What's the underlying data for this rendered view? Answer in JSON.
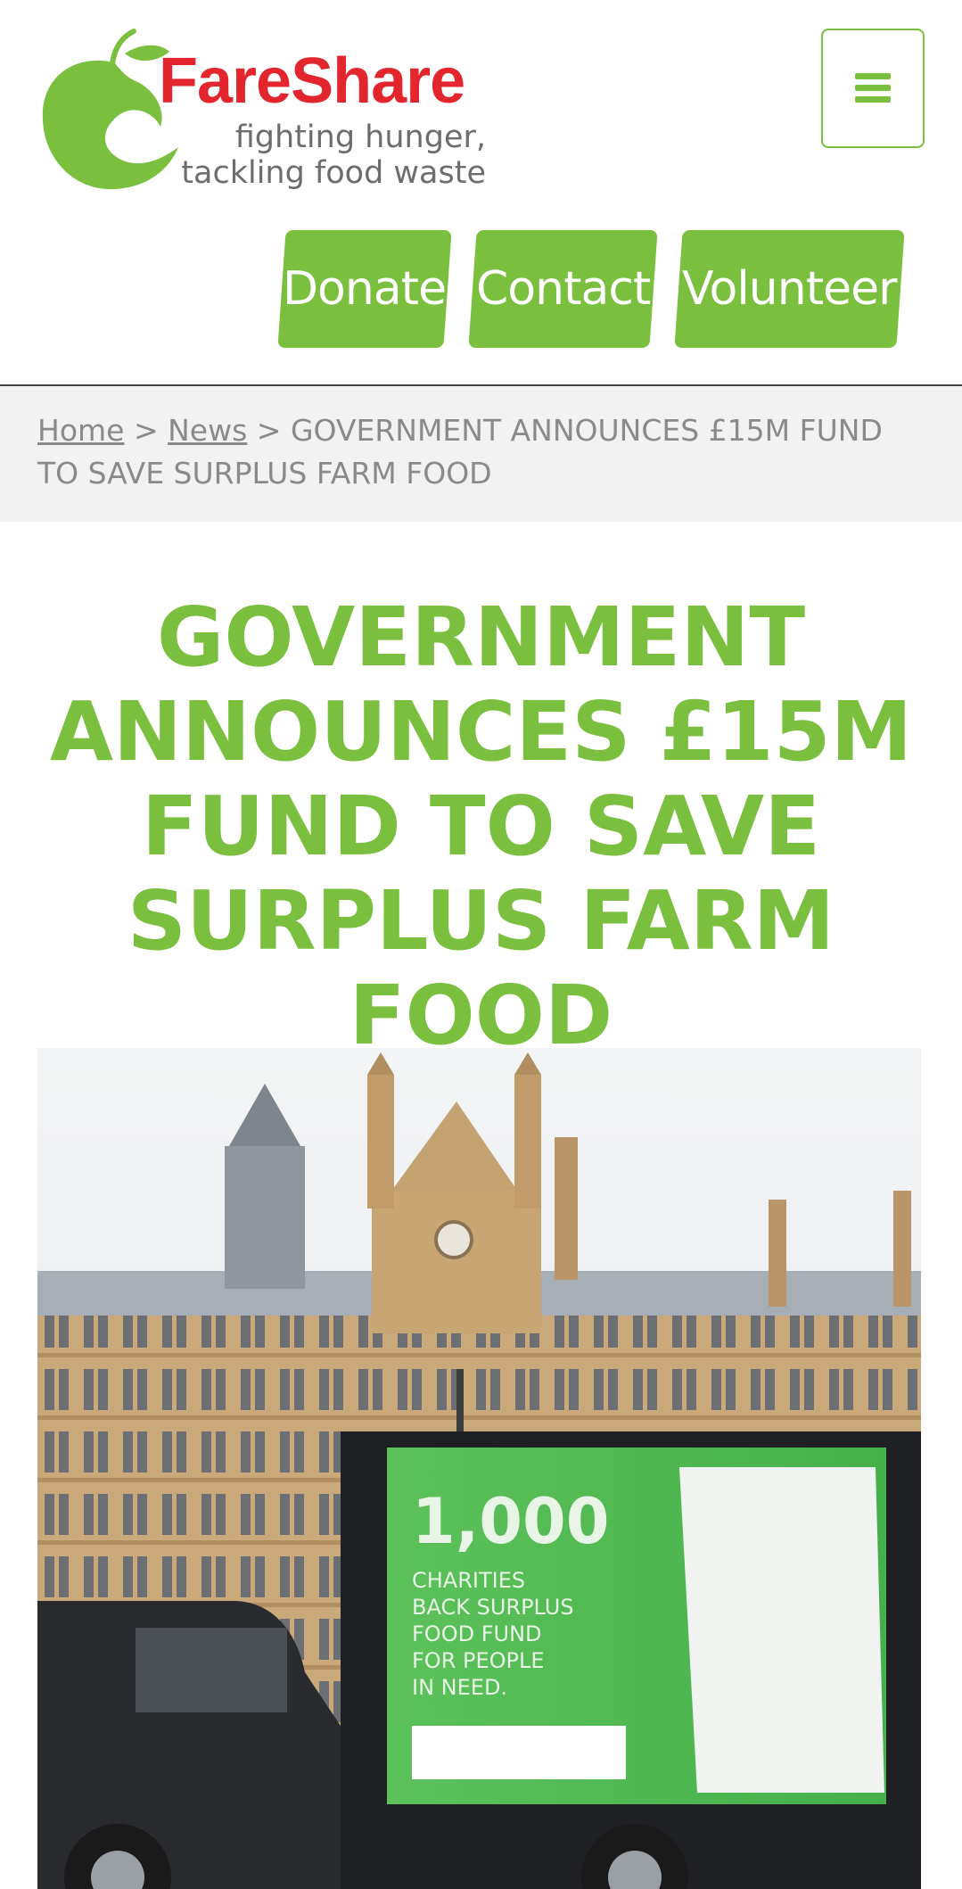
{
  "brand": {
    "name_part1": "Fare",
    "name_part2": "Share",
    "tagline_line1": "fighting hunger,",
    "tagline_line2": "tackling food waste",
    "brand_green": "#7abf3e",
    "brand_red": "#e3262e"
  },
  "header": {
    "menu_icon": "hamburger-menu-icon",
    "buttons": [
      {
        "label": "Donate"
      },
      {
        "label": "Contact"
      },
      {
        "label": "Volunteer"
      }
    ]
  },
  "breadcrumb": {
    "home": "Home",
    "news": "News",
    "separator": ">",
    "current": "GOVERNMENT ANNOUNCES £15M FUND TO SAVE SURPLUS FARM FOOD"
  },
  "article": {
    "title": "GOVERNMENT ANNOUNCES £15M FUND TO SAVE SURPLUS FARM FOOD"
  },
  "hero_image": {
    "billboard_number": "1,000",
    "billboard_line1": "CHARITIES",
    "billboard_line2": "BACK SURPLUS",
    "billboard_line3": "FOOD FUND",
    "billboard_line4": "FOR PEOPLE",
    "billboard_line5": "IN NEED."
  }
}
